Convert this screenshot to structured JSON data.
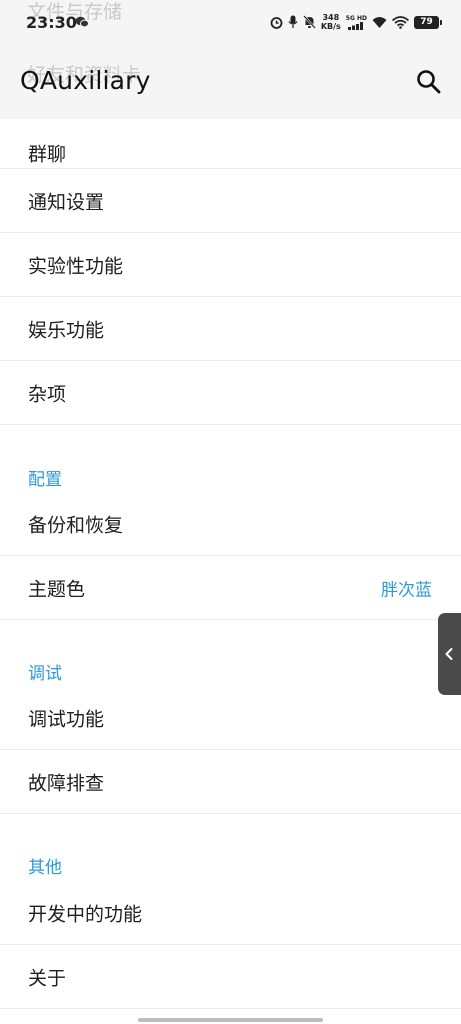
{
  "status_bar": {
    "time": "23:30",
    "net_speed_value": "348",
    "net_speed_unit": "KB/s",
    "network_label": "5G HD",
    "battery": "79"
  },
  "app_bar": {
    "title": "QAuxiliary",
    "behind_text_1": "文件与存储",
    "behind_text_2": "好友和资料卡"
  },
  "menu": {
    "row_group_chat": "群聊",
    "row_notifications": "通知设置",
    "row_experimental": "实验性功能",
    "row_entertainment": "娱乐功能",
    "row_misc": "杂项"
  },
  "config": {
    "header": "配置",
    "backup": "备份和恢复",
    "theme_label": "主题色",
    "theme_value": "胖次蓝"
  },
  "debug": {
    "header": "调试",
    "debug_features": "调试功能",
    "troubleshoot": "故障排查"
  },
  "other": {
    "header": "其他",
    "in_development": "开发中的功能",
    "about": "关于"
  },
  "colors": {
    "accent": "#2d9ad8",
    "text": "#1f1f1f",
    "divider": "#ececec",
    "appbar_bg": "#f5f5f5"
  }
}
